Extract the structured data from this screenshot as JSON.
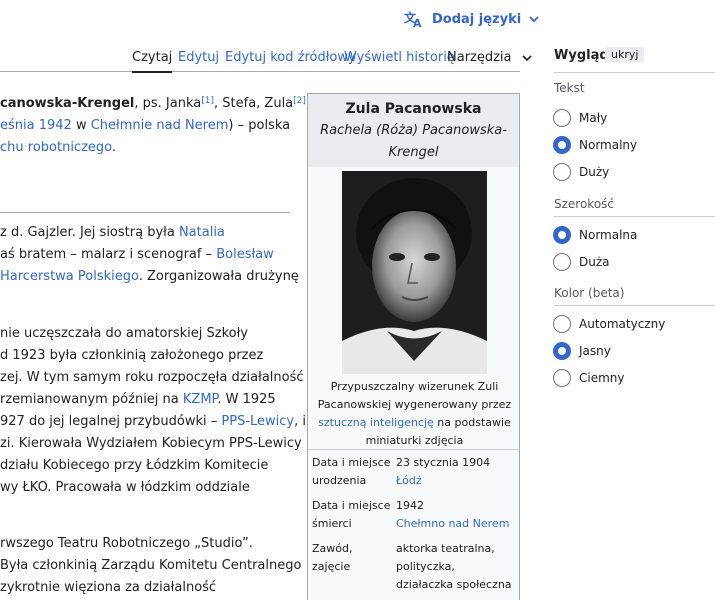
{
  "language": {
    "label": "Dodaj języki"
  },
  "tabs": {
    "read": "Czytaj",
    "edit": "Edytuj",
    "edit_source": "Edytuj kod źródłowy",
    "history": "Wyświetl historię",
    "tools": "Narzędzia"
  },
  "article": {
    "l1_a": "canowska-Krengel",
    "l1_b": ", ps. Janka",
    "l1_ref1": "[1]",
    "l1_c": ", Stefa, Zula",
    "l1_ref2": "[2]",
    "l1_d": ",",
    "l2_a": "eśnia 1942",
    "l2_b": " w ",
    "l2_c": "Chełmnie nad Nerem",
    "l2_d": ") – polska",
    "l3_a": "chu robotniczego",
    "l3_b": ".",
    "l4_a": "z d. Gajzler. Jej siostrą była ",
    "l4_b": "Natalia",
    "l5_a": "aś bratem – malarz i scenograf – ",
    "l5_b": "Bolesław",
    "l6_a": "Harcerstwa Polskiego",
    "l6_b": ". Zorganizowała drużynę",
    "l7": "nie uczęszczała do amatorskiej Szkoły",
    "l8": "d 1923 była członkinią założonego przez",
    "l9": "zej. W tym samym roku rozpoczęła działalność",
    "l10_a": "rzemianowanym później na ",
    "l10_b": "KZMP",
    "l10_c": ". W 1925",
    "l11_a": "927 do jej legalnej przybudówki – ",
    "l11_b": "PPS-Lewicy",
    "l11_c": ", i",
    "l12": "zi. Kierowała Wydziałem Kobiecym PPS-Lewicy",
    "l13": "działu Kobiecego przy Łódzkim Komitecie",
    "l14": "wy ŁKO. Pracowała w łódzkim oddziale",
    "l15": "rwszego Teatru Robotniczego „Studio”.",
    "l16": "Była członkinią Zarządu Komitetu Centralnego",
    "l17": "zykrotnie więziona za działalność"
  },
  "infobox": {
    "title": "Zula Pacanowska",
    "subtitle": "Rachela (Róża) Pacanowska-Krengel",
    "caption_a": "Przypuszczalny wizerunek Zuli Pacanowskiej wygenerowany przez ",
    "caption_link": "sztuczną inteligencję",
    "caption_b": " na podstawie miniaturki zdjęcia",
    "rows": [
      {
        "label": "Data i miejsce urodzenia",
        "value": "23 stycznia 1904",
        "link": "Łódź"
      },
      {
        "label": "Data i miejsce śmierci",
        "value": "1942",
        "link": "Chełmno nad Nerem"
      },
      {
        "label": "Zawód, zajęcie",
        "value": "aktorka teatralna, polityczka, działaczka społeczna",
        "link": ""
      }
    ]
  },
  "panel": {
    "title": "Wygląd",
    "hide": "ukryj",
    "text_label": "Tekst",
    "text_opts": [
      "Mały",
      "Normalny",
      "Duży"
    ],
    "width_label": "Szerokość",
    "width_opts": [
      "Normalna",
      "Duża"
    ],
    "color_label": "Kolor (beta)",
    "color_opts": [
      "Automatyczny",
      "Jasny",
      "Ciemny"
    ]
  },
  "colors": {
    "link": "#3366cc",
    "accent": "#3366cc"
  }
}
